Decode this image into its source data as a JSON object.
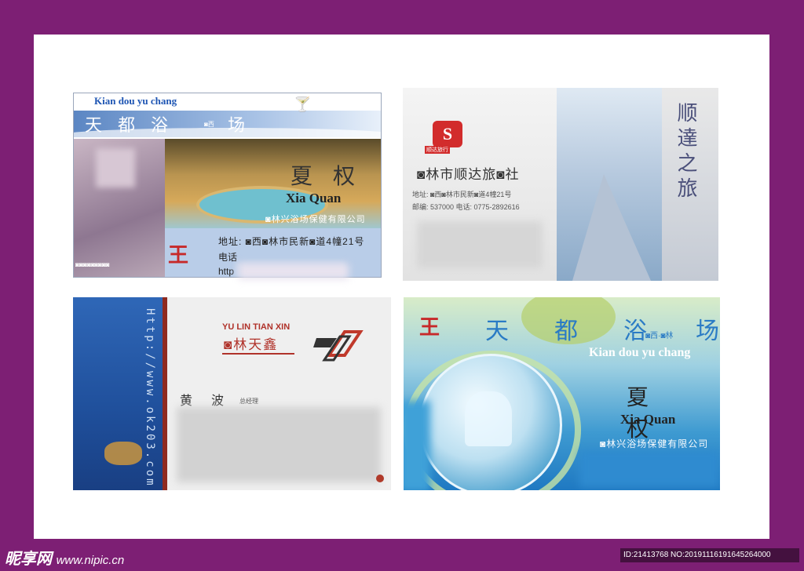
{
  "card1": {
    "pinyin": "Kian dou yu chang",
    "cn_title": "天都浴",
    "cn_sub": "◙西",
    "cn_last": "场",
    "name": "夏权",
    "name_en": "Xia Quan",
    "company": "◙林兴浴场保健有限公司",
    "logo": "王",
    "address": "地址: ◙西◙林市民新◙道4幢21号",
    "tel": "电话",
    "http": "http",
    "caption": "◙◙◙◙◙◙◙◙◙"
  },
  "card2": {
    "logo": "S",
    "logo_text": "顺达旅行",
    "title": "◙林市顺达旅◙社",
    "address": "地址: ◙西◙林市民新◙道4幢21号",
    "postal": "邮编: 537000 电话: 0775-2892616",
    "calligraphy": "顺達之旅"
  },
  "card3": {
    "url": "Http://www.ok203.com",
    "brand_en": "YU LIN TIAN XIN",
    "brand_cn": "◙林天鑫",
    "name": "黄波",
    "title": "总经理"
  },
  "card4": {
    "logo": "王",
    "cn_title": "天都浴",
    "cn_sub": "◙西·◙林",
    "cn_last": "场",
    "pinyin": "Kian dou yu chang",
    "name": "夏权",
    "name_en": "Xia Quan",
    "company": "◙林兴浴场保健有限公司"
  },
  "watermark": {
    "site_cn": "昵享网",
    "site_url": "www.nipic.cn",
    "id_text": "ID:21413768 NO:20191116191645264000"
  }
}
